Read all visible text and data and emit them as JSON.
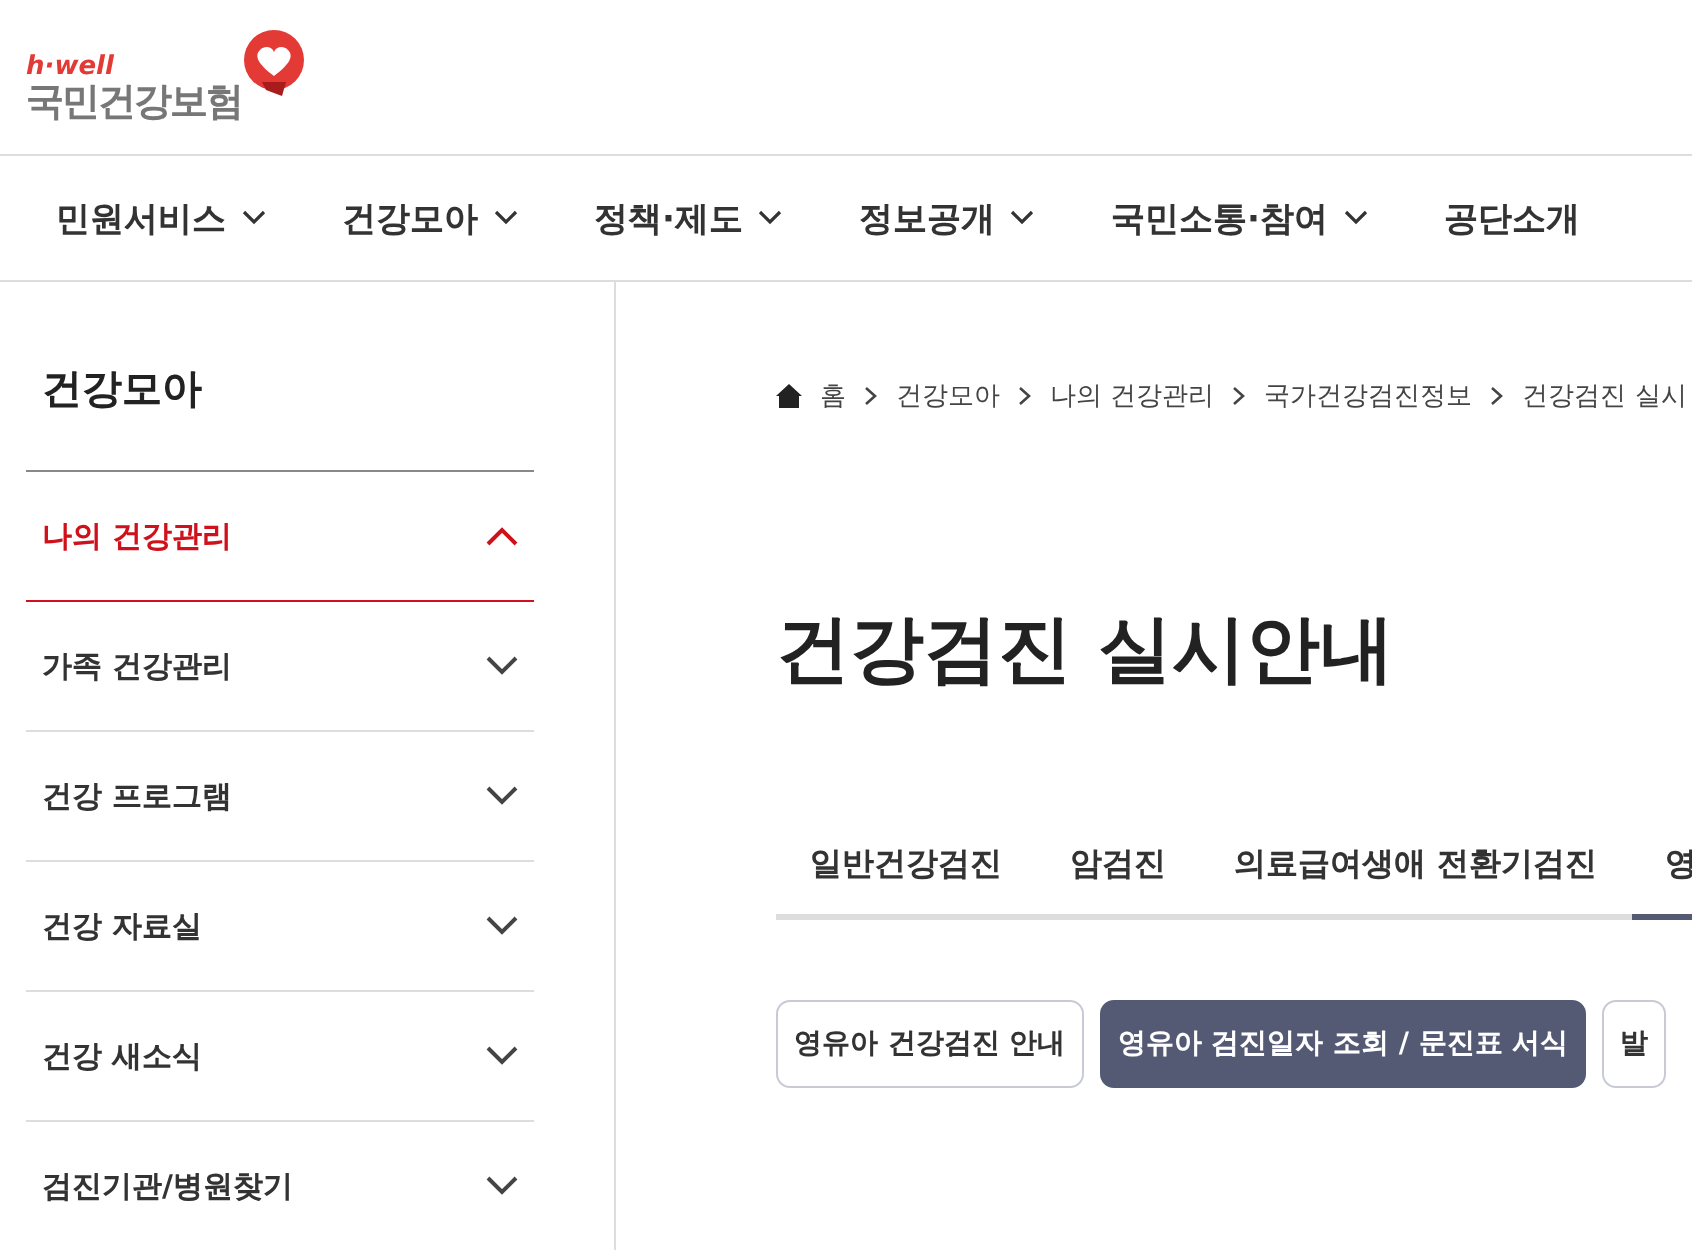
{
  "logo": {
    "tagline": "h·well",
    "name": "국민건강보험"
  },
  "nav": [
    {
      "label": "민원서비스",
      "has_menu": true
    },
    {
      "label": "건강모아",
      "has_menu": true
    },
    {
      "label": "정책·제도",
      "has_menu": true
    },
    {
      "label": "정보공개",
      "has_menu": true
    },
    {
      "label": "국민소통·참여",
      "has_menu": true
    },
    {
      "label": "공단소개",
      "has_menu": false
    }
  ],
  "sidebar": {
    "title": "건강모아",
    "items": [
      {
        "label": "나의 건강관리",
        "expanded": true
      },
      {
        "label": "가족 건강관리",
        "expanded": false
      },
      {
        "label": "건강 프로그램",
        "expanded": false
      },
      {
        "label": "건강 자료실",
        "expanded": false
      },
      {
        "label": "건강 새소식",
        "expanded": false
      },
      {
        "label": "검진기관/병원찾기",
        "expanded": false
      }
    ]
  },
  "breadcrumb": [
    "홈",
    "건강모아",
    "나의 건강관리",
    "국가건강검진정보",
    "건강검진 실시"
  ],
  "page_title": "건강검진 실시안내",
  "tabs": [
    {
      "label": "일반건강검진",
      "selected": false
    },
    {
      "label": "암검진",
      "selected": false
    },
    {
      "label": "의료급여생애 전환기검진",
      "selected": false
    },
    {
      "label": "영",
      "selected": true
    }
  ],
  "sub_buttons": [
    {
      "label": "영유아 건강검진 안내",
      "selected": false
    },
    {
      "label": "영유아 검진일자 조회 / 문진표 서식",
      "selected": true
    },
    {
      "label": "발",
      "selected": false
    }
  ]
}
